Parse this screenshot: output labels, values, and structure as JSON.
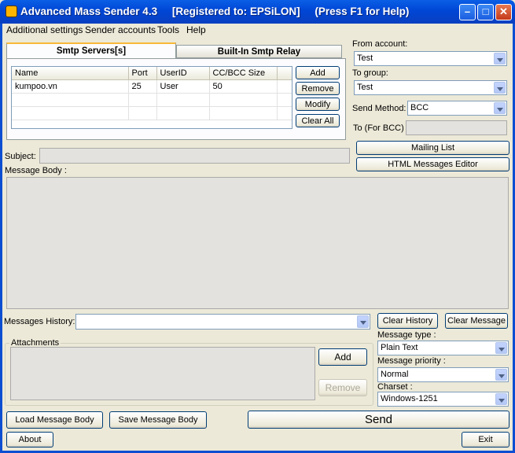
{
  "title": "Advanced Mass Sender 4.3     [Registered to: EPSiLON]     (Press F1 for Help)",
  "menu": [
    "Additional settings",
    "Sender accounts",
    "Tools",
    "Help"
  ],
  "tabs": [
    "Smtp Servers[s]",
    "Built-In Smtp Relay"
  ],
  "smtp_table": {
    "columns": [
      "Name",
      "Port",
      "UserID",
      "CC/BCC Size"
    ],
    "rows": [
      [
        "kumpoo.vn",
        "25",
        "User",
        "50"
      ]
    ]
  },
  "smtp_buttons": {
    "add": "Add",
    "remove": "Remove",
    "modify": "Modify",
    "clear_all": "Clear All"
  },
  "from_account": {
    "label": "From account:",
    "value": "Test"
  },
  "to_group": {
    "label": "To group:",
    "value": "Test"
  },
  "send_method": {
    "label": "Send Method:",
    "value": "BCC"
  },
  "to_bcc": {
    "label": "To (For BCC)",
    "value": ""
  },
  "mailing_list": "Mailing List",
  "html_editor": "HTML Messages Editor",
  "subject": {
    "label": "Subject:",
    "value": ""
  },
  "message_body_label": "Message Body :",
  "history": {
    "label": "Messages History:",
    "value": "",
    "clear_history": "Clear History",
    "clear_message": "Clear Message"
  },
  "attachments": {
    "label": "Attachments",
    "add": "Add",
    "remove": "Remove"
  },
  "message_type": {
    "label": "Message type :",
    "value": "Plain Text"
  },
  "message_priority": {
    "label": "Message priority :",
    "value": "Normal"
  },
  "charset": {
    "label": "Charset :",
    "value": "Windows-1251"
  },
  "load_body": "Load Message Body",
  "save_body": "Save Message Body",
  "send": "Send",
  "about": "About",
  "exit": "Exit",
  "colors": {
    "titlebar": "#0046d5",
    "window": "#ece9d8",
    "close_button": "#c5391a"
  }
}
